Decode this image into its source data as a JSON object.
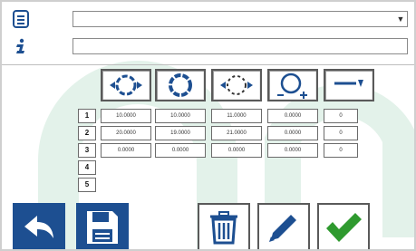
{
  "header": {
    "program_field": {
      "value": "",
      "dropdown_icon": "dropdown-arrow-icon"
    },
    "info_field": {
      "value": ""
    }
  },
  "mode_buttons": [
    {
      "icon": "circle-expand-icon"
    },
    {
      "icon": "circle-solid-icon"
    },
    {
      "icon": "circle-dashed-expand-icon"
    },
    {
      "icon": "circle-tolerance-icon"
    },
    {
      "icon": "line-offset-icon"
    }
  ],
  "table": {
    "row_numbers": [
      "1",
      "2",
      "3",
      "4",
      "5"
    ],
    "rows": [
      [
        "10.0000",
        "10.0000",
        "11.0000",
        "0.0000",
        "0"
      ],
      [
        "20.0000",
        "19.0000",
        "21.0000",
        "0.0000",
        "0"
      ],
      [
        "0.0000",
        "0.0000",
        "0.0000",
        "0.0000",
        "0"
      ]
    ]
  },
  "bottom_buttons": {
    "back": {
      "icon": "back-arrow-icon"
    },
    "save": {
      "icon": "save-icon"
    },
    "delete": {
      "icon": "trash-icon"
    },
    "edit": {
      "icon": "pencil-icon"
    },
    "confirm": {
      "icon": "check-icon"
    }
  },
  "colors": {
    "accent_blue": "#1d4f91",
    "confirm_green": "#2f9a2f",
    "watermark": "#dff0e6"
  }
}
